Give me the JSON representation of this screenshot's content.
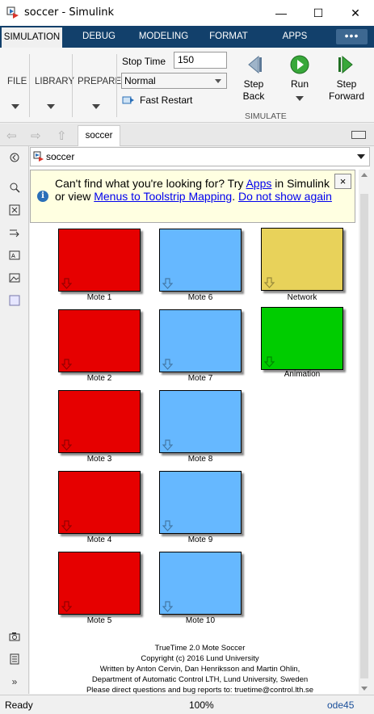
{
  "window": {
    "title": "soccer - Simulink",
    "minimize": "—",
    "maximize": "☐",
    "close": "✕"
  },
  "tabs": [
    {
      "label": "SIMULATION",
      "active": true
    },
    {
      "label": "DEBUG"
    },
    {
      "label": "MODELING"
    },
    {
      "label": "FORMAT"
    },
    {
      "label": "APPS"
    }
  ],
  "tab_more": "•••",
  "toolstrip": {
    "file": "FILE",
    "library": "LIBRARY",
    "prepare": "PREPARE",
    "stop_time_label": "Stop Time",
    "stop_time_value": "150",
    "sim_mode": "Normal",
    "fast_restart": "Fast Restart",
    "step_back": [
      "Step",
      "Back"
    ],
    "run": "Run",
    "step_forward": [
      "Step",
      "Forward"
    ],
    "simulate_group": "SIMULATE"
  },
  "nav": {
    "model_tab": "soccer"
  },
  "address": {
    "path": "soccer"
  },
  "infobar": {
    "prefix": "Can't find what you're looking for? Try ",
    "apps_link": "Apps",
    "middle": " in Simulink or view ",
    "menus_link": "Menus to Toolstrip Mapping",
    "sep": ". ",
    "dismiss_link": "Do not show again",
    "close": "×"
  },
  "blocks": [
    {
      "label": "Mote 1",
      "color": "#e60000"
    },
    {
      "label": "Mote 2",
      "color": "#e60000"
    },
    {
      "label": "Mote 3",
      "color": "#e60000"
    },
    {
      "label": "Mote 4",
      "color": "#e60000"
    },
    {
      "label": "Mote 5",
      "color": "#e60000"
    },
    {
      "label": "Mote 6",
      "color": "#66b8ff"
    },
    {
      "label": "Mote 7",
      "color": "#66b8ff"
    },
    {
      "label": "Mote 8",
      "color": "#66b8ff"
    },
    {
      "label": "Mote 9",
      "color": "#66b8ff"
    },
    {
      "label": "Mote 10",
      "color": "#66b8ff"
    },
    {
      "label": "Network",
      "color": "#e8d25a"
    },
    {
      "label": "Animation",
      "color": "#00cc00"
    }
  ],
  "footer": [
    "TrueTime 2.0  Mote Soccer",
    "Copyright (c) 2016 Lund University",
    "Written by Anton Cervin, Dan Henriksson and Martin Ohlin,",
    "Department of Automatic Control LTH, Lund University, Sweden",
    "Please direct questions and bug reports to: truetime@control.lth.se"
  ],
  "status": {
    "ready": "Ready",
    "zoom": "100%",
    "solver": "ode45"
  },
  "colors": {
    "tabstrip": "#12406b",
    "link": "#0000ee",
    "info_bg": "#ffffe1"
  }
}
